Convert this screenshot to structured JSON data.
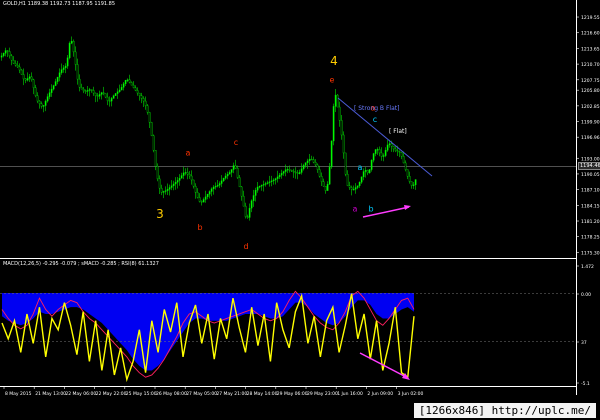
{
  "header": {
    "symbol_info": "GOLD,H1  1189.38 1192.73 1187.95 1191.85"
  },
  "macd_panel": {
    "info": "MACD(12,26,5) -0.295 -0.079 ; sMACD -0.285 ; RSI(8) 61.1327"
  },
  "watermark": "[1266x846] http://uplc.me/",
  "current_price_tag": "1194.46",
  "chart_data": [
    {
      "type": "candlestick",
      "instrument": "GOLD,H1",
      "ylim": [
        1175.0,
        1222.0
      ],
      "price_ticks": [
        "1219.55",
        "1216.60",
        "1213.65",
        "1210.70",
        "1207.75",
        "1205.80",
        "1202.85",
        "1199.90",
        "1196.96",
        "1193.00",
        "1190.05",
        "1187.10",
        "1184.15",
        "1181.20",
        "1178.25",
        "1175.30"
      ],
      "tick_values": [
        1219.55,
        1216.6,
        1213.65,
        1210.7,
        1207.75,
        1205.8,
        1202.85,
        1199.9,
        1196.96,
        1193.0,
        1190.05,
        1187.1,
        1184.15,
        1181.2,
        1178.25,
        1175.3
      ],
      "current_price": 1194.46,
      "close_path": [
        [
          0,
          1212.0
        ],
        [
          6,
          1213.5
        ],
        [
          12,
          1211.0
        ],
        [
          18,
          1210.0
        ],
        [
          24,
          1207.5
        ],
        [
          30,
          1208.5
        ],
        [
          36,
          1204.0
        ],
        [
          42,
          1202.5
        ],
        [
          48,
          1205.0
        ],
        [
          54,
          1207.0
        ],
        [
          60,
          1209.5
        ],
        [
          66,
          1210.5
        ],
        [
          70,
          1216.0
        ],
        [
          74,
          1212.0
        ],
        [
          78,
          1206.5
        ],
        [
          84,
          1205.5
        ],
        [
          90,
          1206.0
        ],
        [
          96,
          1204.5
        ],
        [
          102,
          1205.5
        ],
        [
          108,
          1203.5
        ],
        [
          114,
          1205.0
        ],
        [
          120,
          1206.0
        ],
        [
          126,
          1208.0
        ],
        [
          132,
          1206.5
        ],
        [
          138,
          1205.0
        ],
        [
          144,
          1203.5
        ],
        [
          148,
          1201.0
        ],
        [
          152,
          1196.0
        ],
        [
          156,
          1190.0
        ],
        [
          160,
          1186.5
        ],
        [
          166,
          1187.0
        ],
        [
          172,
          1188.0
        ],
        [
          178,
          1189.0
        ],
        [
          184,
          1190.5
        ],
        [
          190,
          1189.5
        ],
        [
          196,
          1186.0
        ],
        [
          200,
          1184.5
        ],
        [
          206,
          1186.0
        ],
        [
          212,
          1187.5
        ],
        [
          218,
          1188.0
        ],
        [
          224,
          1189.5
        ],
        [
          230,
          1190.5
        ],
        [
          234,
          1192.0
        ],
        [
          238,
          1188.5
        ],
        [
          242,
          1185.0
        ],
        [
          246,
          1181.0
        ],
        [
          250,
          1184.5
        ],
        [
          256,
          1187.5
        ],
        [
          262,
          1188.0
        ],
        [
          268,
          1188.5
        ],
        [
          274,
          1189.0
        ],
        [
          280,
          1190.0
        ],
        [
          286,
          1191.0
        ],
        [
          292,
          1190.5
        ],
        [
          298,
          1190.0
        ],
        [
          304,
          1192.0
        ],
        [
          310,
          1193.0
        ],
        [
          316,
          1191.5
        ],
        [
          320,
          1189.0
        ],
        [
          326,
          1186.5
        ],
        [
          330,
          1193.0
        ],
        [
          334,
          1206.0
        ],
        [
          338,
          1201.5
        ],
        [
          342,
          1196.0
        ],
        [
          346,
          1188.0
        ],
        [
          352,
          1187.0
        ],
        [
          358,
          1188.0
        ],
        [
          364,
          1191.0
        ],
        [
          368,
          1190.0
        ],
        [
          372,
          1193.5
        ],
        [
          376,
          1195.0
        ],
        [
          382,
          1193.0
        ],
        [
          388,
          1196.0
        ],
        [
          394,
          1194.5
        ],
        [
          400,
          1194.0
        ],
        [
          404,
          1191.5
        ],
        [
          408,
          1189.0
        ],
        [
          412,
          1187.5
        ],
        [
          416,
          1189.5
        ]
      ],
      "wave_labels": [
        {
          "text": "3",
          "x": 160,
          "y": 1181.8,
          "color": "#ffcc00"
        },
        {
          "text": "4",
          "x": 334,
          "y": 1210.5,
          "color": "#ffcc00"
        },
        {
          "text": "a",
          "x": 188,
          "y": 1193.5,
          "color": "#ff3300"
        },
        {
          "text": "b",
          "x": 200,
          "y": 1179.5,
          "color": "#ff3300"
        },
        {
          "text": "c",
          "x": 236,
          "y": 1195.5,
          "color": "#ff3300"
        },
        {
          "text": "d",
          "x": 246,
          "y": 1175.9,
          "color": "#ff3300"
        },
        {
          "text": "e",
          "x": 332,
          "y": 1207.2,
          "color": "#ff3300"
        },
        {
          "text": "b",
          "x": 371,
          "y": 1183.0,
          "color": "#00ccff"
        },
        {
          "text": "c",
          "x": 375,
          "y": 1199.8,
          "color": "#00ccff"
        },
        {
          "text": "a",
          "x": 360,
          "y": 1190.8,
          "color": "#00ccff"
        },
        {
          "text": "a",
          "x": 355,
          "y": 1183.0,
          "color": "#cc00cc"
        },
        {
          "text": "a",
          "x": 373,
          "y": 1202.0,
          "color": "#ff3300"
        }
      ],
      "pattern_labels": [
        "[ Strong B Flat]",
        "[ Flat]"
      ]
    },
    {
      "type": "line",
      "indicator": "MACD / RSI",
      "ylim": [
        -1.1,
        1.6
      ],
      "yticks": [
        "1.472",
        "0.00",
        "37",
        "-5.1"
      ],
      "x_ticks": [
        "8 May 2015",
        "21 May 13:00",
        "22 May 06:00",
        "22 May 22:00",
        "25 May 15:00",
        "26 May 08:00",
        "27 May 05:00",
        "27 May 21:00",
        "28 May 14:00",
        "29 May 06:00",
        "29 May 23:00",
        "1 Jun 16:00",
        "2 Jun 09:00",
        "3 Jun 02:00"
      ],
      "series": [
        {
          "values": [
            0.55,
            0.35,
            0.2,
            0.12,
            0.2,
            0.45,
            0.8,
            0.55,
            0.4,
            0.55,
            0.65,
            0.75,
            0.7,
            0.5,
            0.35,
            0.25,
            0.1,
            -0.05,
            -0.2,
            -0.35,
            -0.5,
            -0.7,
            -0.85,
            -0.95,
            -0.9,
            -0.75,
            -0.55,
            -0.3,
            -0.05,
            0.25,
            0.45,
            0.5,
            0.4,
            0.3,
            0.25,
            0.3,
            0.35,
            0.4,
            0.45,
            0.5,
            0.55,
            0.45,
            0.35,
            0.3,
            0.35,
            0.5,
            0.75,
            0.95,
            0.8,
            0.6,
            0.4,
            0.25,
            0.15,
            0.1,
            0.25,
            0.5,
            0.85,
            0.95,
            0.8,
            0.55,
            0.3,
            0.2,
            0.35,
            0.55,
            0.75,
            0.8,
            0.55
          ]
        },
        {
          "values": [
            0.4,
            0.3,
            0.25,
            0.2,
            0.25,
            0.35,
            0.5,
            0.45,
            0.45,
            0.5,
            0.55,
            0.6,
            0.6,
            0.55,
            0.45,
            0.35,
            0.25,
            0.1,
            -0.05,
            -0.2,
            -0.35,
            -0.55,
            -0.7,
            -0.8,
            -0.8,
            -0.7,
            -0.55,
            -0.35,
            -0.15,
            0.05,
            0.25,
            0.35,
            0.35,
            0.3,
            0.3,
            0.3,
            0.3,
            0.35,
            0.4,
            0.45,
            0.45,
            0.45,
            0.4,
            0.35,
            0.35,
            0.4,
            0.55,
            0.7,
            0.7,
            0.6,
            0.45,
            0.35,
            0.25,
            0.2,
            0.25,
            0.4,
            0.6,
            0.75,
            0.75,
            0.65,
            0.45,
            0.35,
            0.35,
            0.45,
            0.55,
            0.6,
            0.5
          ]
        },
        {
          "values": [
            0.25,
            -0.1,
            0.3,
            -0.4,
            0.45,
            -0.2,
            0.6,
            -0.5,
            0.35,
            0.1,
            0.7,
            0.2,
            -0.45,
            0.5,
            -0.6,
            0.3,
            -0.8,
            0.1,
            -0.9,
            -0.3,
            -1.0,
            -0.6,
            0.1,
            -0.85,
            0.3,
            -0.4,
            0.55,
            0.05,
            0.7,
            -0.5,
            0.25,
            0.65,
            -0.2,
            0.45,
            -0.55,
            0.35,
            -0.1,
            0.8,
            0.15,
            -0.4,
            0.6,
            -0.25,
            0.45,
            -0.6,
            0.7,
            0.1,
            -0.3,
            0.5,
            0.85,
            -0.2,
            0.4,
            -0.5,
            0.3,
            0.6,
            -0.4,
            0.2,
            0.9,
            -0.1,
            0.45,
            -0.55,
            0.3,
            -0.8,
            -0.2,
            0.6,
            -0.85,
            -0.95,
            0.4
          ]
        }
      ]
    }
  ]
}
